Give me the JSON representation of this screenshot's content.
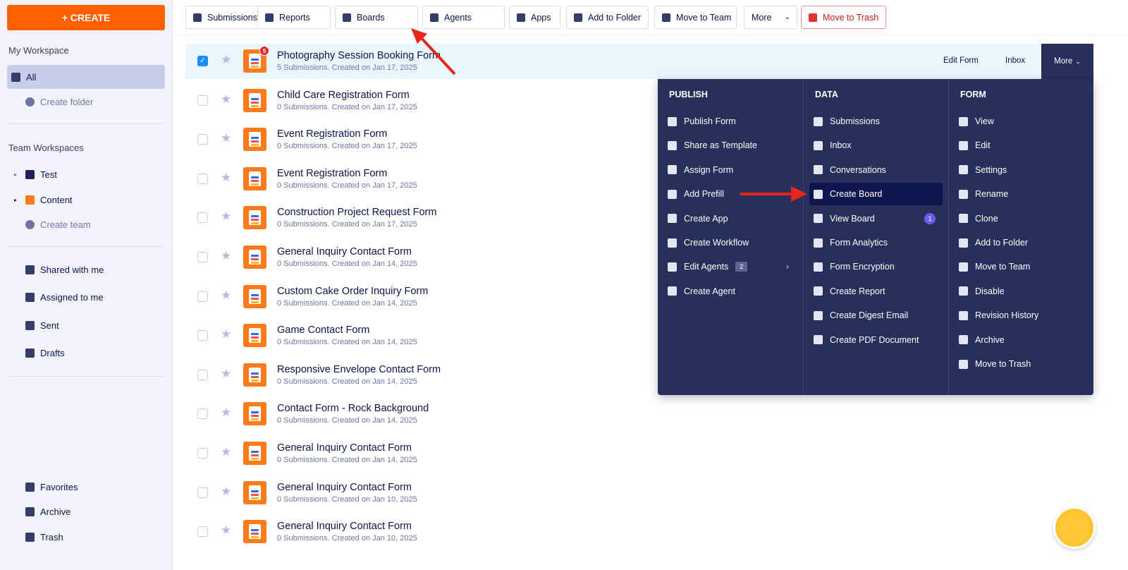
{
  "sidebar": {
    "create_label": "+ CREATE",
    "my_workspace": "My Workspace",
    "all": "All",
    "create_folder": "Create folder",
    "team_workspaces": "Team Workspaces",
    "teams": [
      "Test",
      "Content"
    ],
    "create_team": "Create team",
    "links": [
      "Shared with me",
      "Assigned to me",
      "Sent",
      "Drafts"
    ],
    "bottom": [
      "Favorites",
      "Archive",
      "Trash"
    ]
  },
  "toolbar": [
    "Submissions",
    "Reports",
    "Boards",
    "Agents",
    "Apps",
    "Add to Folder",
    "Move to Team",
    "More",
    "Move to Trash"
  ],
  "forms": [
    {
      "title": "Photography Session Booking Form",
      "sub": "5 Submissions. Created on Jan 17, 2025",
      "badge": "5",
      "selected": true
    },
    {
      "title": "Child Care Registration Form",
      "sub": "0 Submissions. Created on Jan 17, 2025"
    },
    {
      "title": "Event Registration Form",
      "sub": "0 Submissions. Created on Jan 17, 2025"
    },
    {
      "title": "Event Registration Form",
      "sub": "0 Submissions. Created on Jan 17, 2025"
    },
    {
      "title": "Construction Project Request Form",
      "sub": "0 Submissions. Created on Jan 17, 2025"
    },
    {
      "title": "General Inquiry Contact Form",
      "sub": "0 Submissions. Created on Jan 14, 2025"
    },
    {
      "title": "Custom Cake Order Inquiry Form",
      "sub": "0 Submissions. Created on Jan 14, 2025"
    },
    {
      "title": "Game Contact Form",
      "sub": "0 Submissions. Created on Jan 14, 2025"
    },
    {
      "title": "Responsive Envelope Contact Form",
      "sub": "0 Submissions. Created on Jan 14, 2025"
    },
    {
      "title": "Contact Form - Rock Background",
      "sub": "0 Submissions. Created on Jan 14, 2025"
    },
    {
      "title": "General Inquiry Contact Form",
      "sub": "0 Submissions. Created on Jan 14, 2025"
    },
    {
      "title": "General Inquiry Contact Form",
      "sub": "0 Submissions. Created on Jan 10, 2025"
    },
    {
      "title": "General Inquiry Contact Form",
      "sub": "0 Submissions. Created on Jan 10, 2025"
    }
  ],
  "row_actions": {
    "edit": "Edit Form",
    "inbox": "Inbox",
    "more": "More"
  },
  "menu": [
    {
      "head": "PUBLISH",
      "items": [
        {
          "label": "Publish Form"
        },
        {
          "label": "Share as Template"
        },
        {
          "label": "Assign Form"
        },
        {
          "label": "Add Prefill"
        },
        {
          "label": "Create App"
        },
        {
          "label": "Create Workflow"
        },
        {
          "label": "Edit Agents",
          "count": "2",
          "sub": true
        },
        {
          "label": "Create Agent"
        }
      ]
    },
    {
      "head": "DATA",
      "items": [
        {
          "label": "Submissions"
        },
        {
          "label": "Inbox"
        },
        {
          "label": "Conversations"
        },
        {
          "label": "Create Board",
          "highlight": true
        },
        {
          "label": "View Board",
          "badge": "1"
        },
        {
          "label": "Form Analytics"
        },
        {
          "label": "Form Encryption"
        },
        {
          "label": "Create Report"
        },
        {
          "label": "Create Digest Email"
        },
        {
          "label": "Create PDF Document"
        }
      ]
    },
    {
      "head": "FORM",
      "items": [
        {
          "label": "View"
        },
        {
          "label": "Edit"
        },
        {
          "label": "Settings"
        },
        {
          "label": "Rename"
        },
        {
          "label": "Clone"
        },
        {
          "label": "Add to Folder"
        },
        {
          "label": "Move to Team"
        },
        {
          "label": "Disable"
        },
        {
          "label": "Revision History"
        },
        {
          "label": "Archive"
        },
        {
          "label": "Move to Trash"
        }
      ]
    }
  ],
  "colors": {
    "brand": "#ff6100",
    "menu_bg": "#272f5b",
    "annotation": "#e8251b"
  }
}
